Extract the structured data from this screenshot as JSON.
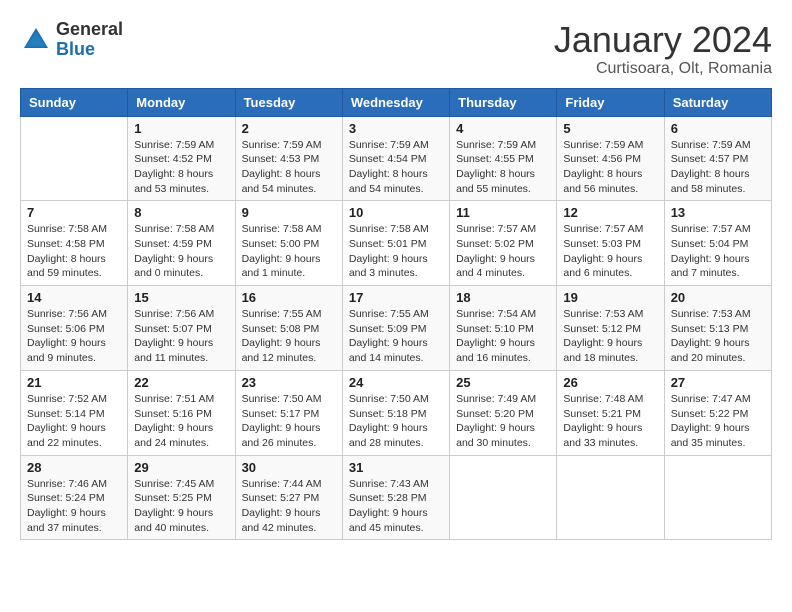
{
  "logo": {
    "general": "General",
    "blue": "Blue"
  },
  "title": "January 2024",
  "subtitle": "Curtisoara, Olt, Romania",
  "days_header": [
    "Sunday",
    "Monday",
    "Tuesday",
    "Wednesday",
    "Thursday",
    "Friday",
    "Saturday"
  ],
  "weeks": [
    [
      {
        "day": "",
        "detail": ""
      },
      {
        "day": "1",
        "detail": "Sunrise: 7:59 AM\nSunset: 4:52 PM\nDaylight: 8 hours\nand 53 minutes."
      },
      {
        "day": "2",
        "detail": "Sunrise: 7:59 AM\nSunset: 4:53 PM\nDaylight: 8 hours\nand 54 minutes."
      },
      {
        "day": "3",
        "detail": "Sunrise: 7:59 AM\nSunset: 4:54 PM\nDaylight: 8 hours\nand 54 minutes."
      },
      {
        "day": "4",
        "detail": "Sunrise: 7:59 AM\nSunset: 4:55 PM\nDaylight: 8 hours\nand 55 minutes."
      },
      {
        "day": "5",
        "detail": "Sunrise: 7:59 AM\nSunset: 4:56 PM\nDaylight: 8 hours\nand 56 minutes."
      },
      {
        "day": "6",
        "detail": "Sunrise: 7:59 AM\nSunset: 4:57 PM\nDaylight: 8 hours\nand 58 minutes."
      }
    ],
    [
      {
        "day": "7",
        "detail": "Sunrise: 7:58 AM\nSunset: 4:58 PM\nDaylight: 8 hours\nand 59 minutes."
      },
      {
        "day": "8",
        "detail": "Sunrise: 7:58 AM\nSunset: 4:59 PM\nDaylight: 9 hours\nand 0 minutes."
      },
      {
        "day": "9",
        "detail": "Sunrise: 7:58 AM\nSunset: 5:00 PM\nDaylight: 9 hours\nand 1 minute."
      },
      {
        "day": "10",
        "detail": "Sunrise: 7:58 AM\nSunset: 5:01 PM\nDaylight: 9 hours\nand 3 minutes."
      },
      {
        "day": "11",
        "detail": "Sunrise: 7:57 AM\nSunset: 5:02 PM\nDaylight: 9 hours\nand 4 minutes."
      },
      {
        "day": "12",
        "detail": "Sunrise: 7:57 AM\nSunset: 5:03 PM\nDaylight: 9 hours\nand 6 minutes."
      },
      {
        "day": "13",
        "detail": "Sunrise: 7:57 AM\nSunset: 5:04 PM\nDaylight: 9 hours\nand 7 minutes."
      }
    ],
    [
      {
        "day": "14",
        "detail": "Sunrise: 7:56 AM\nSunset: 5:06 PM\nDaylight: 9 hours\nand 9 minutes."
      },
      {
        "day": "15",
        "detail": "Sunrise: 7:56 AM\nSunset: 5:07 PM\nDaylight: 9 hours\nand 11 minutes."
      },
      {
        "day": "16",
        "detail": "Sunrise: 7:55 AM\nSunset: 5:08 PM\nDaylight: 9 hours\nand 12 minutes."
      },
      {
        "day": "17",
        "detail": "Sunrise: 7:55 AM\nSunset: 5:09 PM\nDaylight: 9 hours\nand 14 minutes."
      },
      {
        "day": "18",
        "detail": "Sunrise: 7:54 AM\nSunset: 5:10 PM\nDaylight: 9 hours\nand 16 minutes."
      },
      {
        "day": "19",
        "detail": "Sunrise: 7:53 AM\nSunset: 5:12 PM\nDaylight: 9 hours\nand 18 minutes."
      },
      {
        "day": "20",
        "detail": "Sunrise: 7:53 AM\nSunset: 5:13 PM\nDaylight: 9 hours\nand 20 minutes."
      }
    ],
    [
      {
        "day": "21",
        "detail": "Sunrise: 7:52 AM\nSunset: 5:14 PM\nDaylight: 9 hours\nand 22 minutes."
      },
      {
        "day": "22",
        "detail": "Sunrise: 7:51 AM\nSunset: 5:16 PM\nDaylight: 9 hours\nand 24 minutes."
      },
      {
        "day": "23",
        "detail": "Sunrise: 7:50 AM\nSunset: 5:17 PM\nDaylight: 9 hours\nand 26 minutes."
      },
      {
        "day": "24",
        "detail": "Sunrise: 7:50 AM\nSunset: 5:18 PM\nDaylight: 9 hours\nand 28 minutes."
      },
      {
        "day": "25",
        "detail": "Sunrise: 7:49 AM\nSunset: 5:20 PM\nDaylight: 9 hours\nand 30 minutes."
      },
      {
        "day": "26",
        "detail": "Sunrise: 7:48 AM\nSunset: 5:21 PM\nDaylight: 9 hours\nand 33 minutes."
      },
      {
        "day": "27",
        "detail": "Sunrise: 7:47 AM\nSunset: 5:22 PM\nDaylight: 9 hours\nand 35 minutes."
      }
    ],
    [
      {
        "day": "28",
        "detail": "Sunrise: 7:46 AM\nSunset: 5:24 PM\nDaylight: 9 hours\nand 37 minutes."
      },
      {
        "day": "29",
        "detail": "Sunrise: 7:45 AM\nSunset: 5:25 PM\nDaylight: 9 hours\nand 40 minutes."
      },
      {
        "day": "30",
        "detail": "Sunrise: 7:44 AM\nSunset: 5:27 PM\nDaylight: 9 hours\nand 42 minutes."
      },
      {
        "day": "31",
        "detail": "Sunrise: 7:43 AM\nSunset: 5:28 PM\nDaylight: 9 hours\nand 45 minutes."
      },
      {
        "day": "",
        "detail": ""
      },
      {
        "day": "",
        "detail": ""
      },
      {
        "day": "",
        "detail": ""
      }
    ]
  ]
}
